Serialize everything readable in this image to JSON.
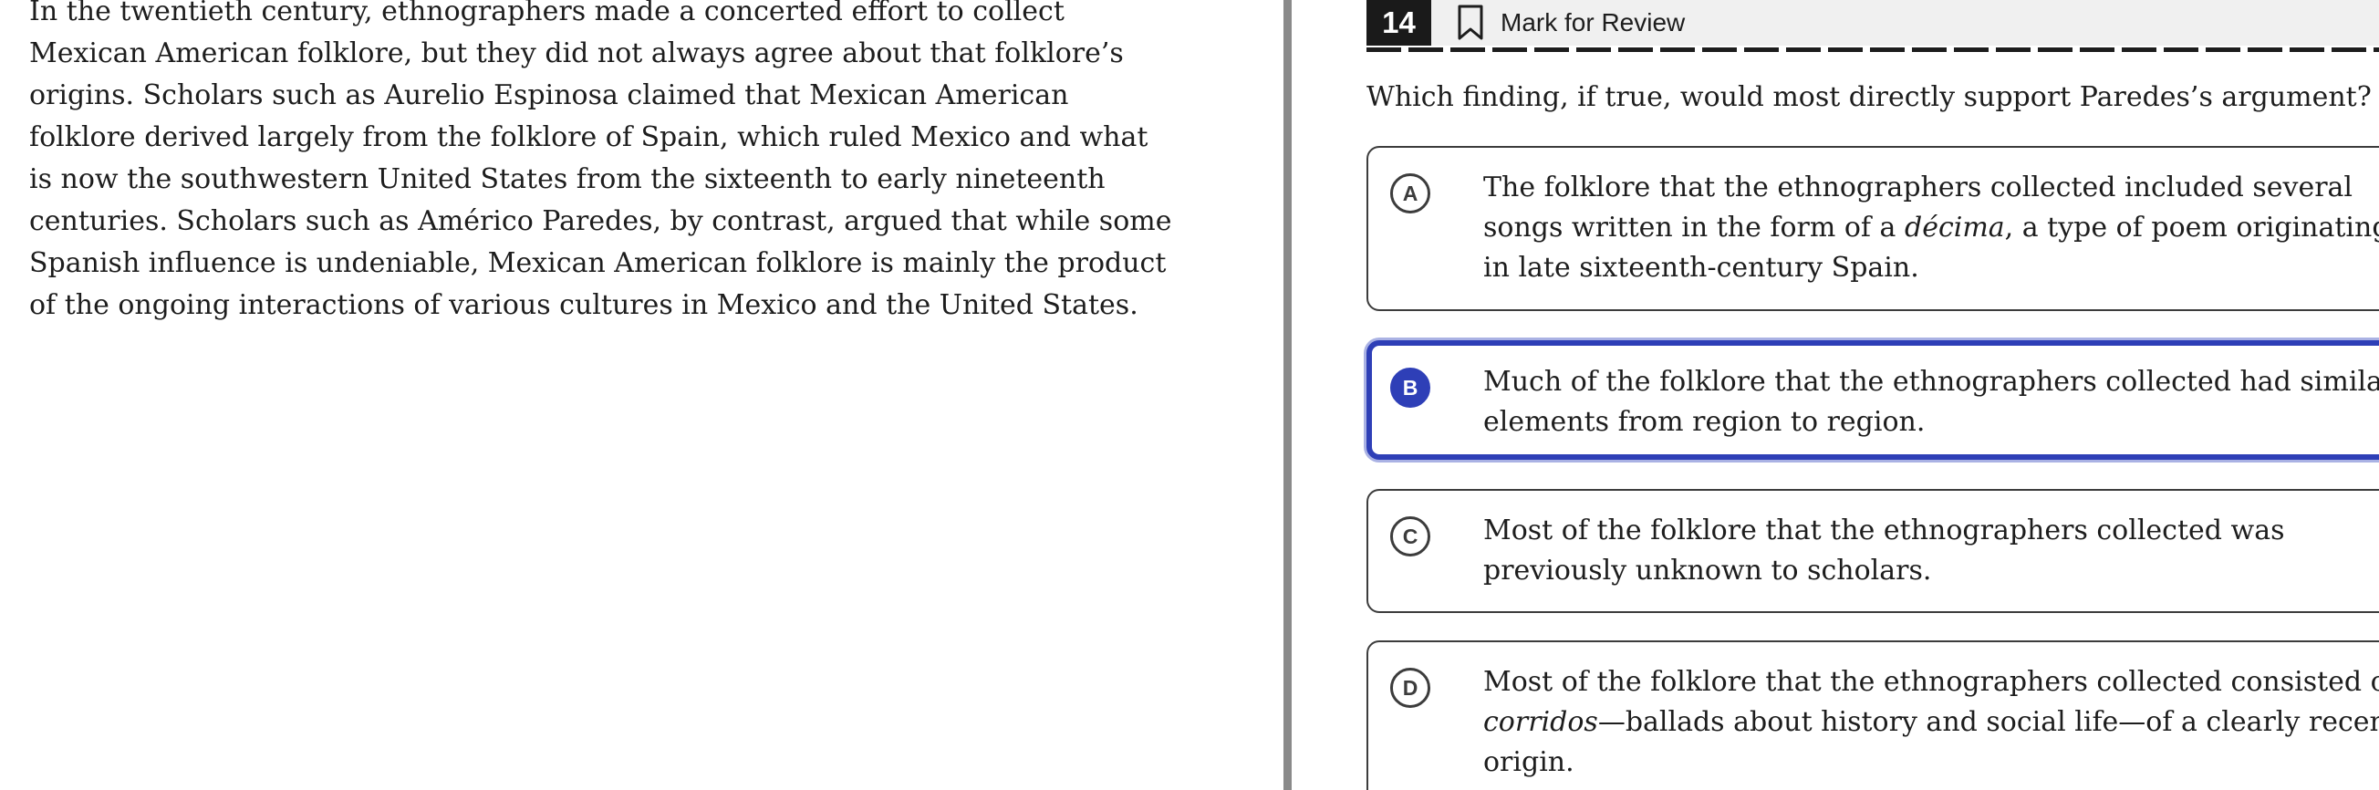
{
  "passage": {
    "text": "In the twentieth century, ethnographers made a concerted effort to collect Mexican American folklore, but they did not always agree about that folklore’s origins. Scholars such as Aurelio Espinosa claimed that Mexican American folklore derived largely from the folklore of Spain, which ruled Mexico and what is now the southwestern United States from the sixteenth to early nineteenth centuries. Scholars such as Américo Paredes, by contrast, argued that while some Spanish influence is undeniable, Mexican American folklore is mainly the product of the ongoing interactions of various cultures in Mexico and the United States."
  },
  "header": {
    "question_number": "14",
    "mark_for_review_label": "Mark for Review",
    "bookmark_icon": "bookmark-outline-icon"
  },
  "question": {
    "prompt": "Which finding, if true, would most directly support Paredes’s argument?"
  },
  "choices": [
    {
      "letter": "A",
      "text_before": "The folklore that the ethnographers collected included several songs written in the form of a ",
      "emphasis": "décima",
      "text_after": ", a type of poem originating in late sixteenth-century Spain.",
      "selected": false
    },
    {
      "letter": "B",
      "text_before": "Much of the folklore that the ethnographers collected had similar elements from region to region.",
      "emphasis": "",
      "text_after": "",
      "selected": true
    },
    {
      "letter": "C",
      "text_before": "Most of the folklore that the ethnographers collected was previously unknown to scholars.",
      "emphasis": "",
      "text_after": "",
      "selected": false
    },
    {
      "letter": "D",
      "text_before": "Most of the folklore that the ethnographers collected consisted of ",
      "emphasis": "corridos",
      "text_after": "—ballads about history and social life—of a clearly recent origin.",
      "selected": false
    }
  ],
  "colors": {
    "selected_accent": "#2e3fb7",
    "divider": "#8a8a8a",
    "header_background": "#f0f0f0",
    "question_number_background": "#1a1a1a"
  }
}
